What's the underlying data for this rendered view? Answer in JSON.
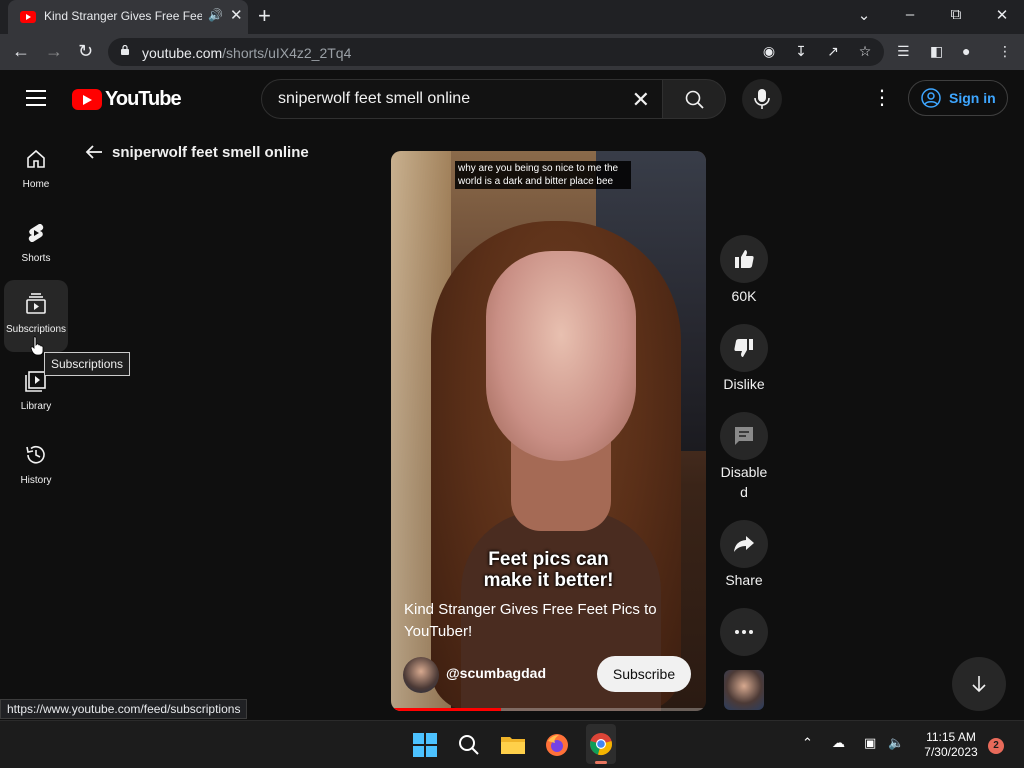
{
  "browser": {
    "tab_title": "Kind Stranger Gives Free Feet Pics to YouTuber!",
    "url_host": "youtube.com",
    "url_path": "/shorts/uIX4z2_2Tq4",
    "status_url": "https://www.youtube.com/feed/subscriptions"
  },
  "header": {
    "logo_text": "YouTube",
    "search_query": "sniperwolf feet smell online",
    "signin_label": "Sign in"
  },
  "sidebar": {
    "items": [
      {
        "label": "Home",
        "icon": "home-icon"
      },
      {
        "label": "Shorts",
        "icon": "shorts-icon"
      },
      {
        "label": "Subscriptions",
        "icon": "subscriptions-icon"
      },
      {
        "label": "Library",
        "icon": "library-icon"
      },
      {
        "label": "History",
        "icon": "history-icon"
      }
    ],
    "tooltip": "Subscriptions"
  },
  "main": {
    "query_title": "sniperwolf feet smell online"
  },
  "short": {
    "top_caption": "why are you being so nice to me the world is a dark and bitter place bee",
    "big_caption_line1": "Feet pics can",
    "big_caption_line2": "make it better!",
    "title": "Kind Stranger Gives Free Feet Pics to YouTuber!",
    "channel": "@scumbagdad",
    "subscribe_label": "Subscribe",
    "progress": 0.35
  },
  "actions": {
    "likes": "60K",
    "dislike_label": "Dislike",
    "comments_line1": "Disable",
    "comments_line2": "d",
    "share_label": "Share"
  },
  "taskbar": {
    "time": "11:15 AM",
    "date": "7/30/2023",
    "notification_count": "2"
  },
  "colors": {
    "yt_red": "#ff0000",
    "link_blue": "#3ea6ff",
    "bg": "#0f0f0f"
  }
}
